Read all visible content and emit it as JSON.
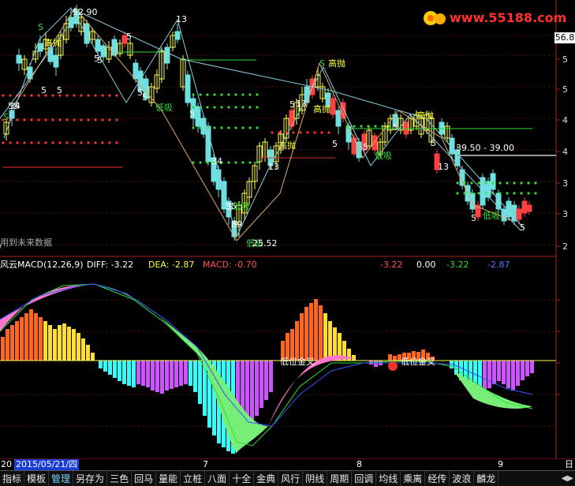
{
  "price_panel": {
    "high_label": "52.90",
    "low_label": "25.52",
    "right_axis_box": "56.8",
    "right_ticks": [
      "5",
      "5",
      "4",
      "4",
      "3",
      "3",
      "2"
    ],
    "range_label": "39.50 - 39.00",
    "future_data_note": "用到未来数据",
    "wave_labels": [
      "5",
      "5",
      "5",
      "5",
      "5",
      "13",
      "5",
      "5",
      "5",
      "13",
      "5",
      "5",
      "5",
      "5",
      "55",
      "34",
      "13",
      "5",
      "5",
      "5",
      "13",
      "34",
      "5",
      "55",
      "89"
    ],
    "signal_top": "S",
    "signal_gao": "高抛",
    "signal_di": "低吸",
    "signal_s": "S"
  },
  "macd_panel": {
    "title": "风云MACD(12,26,9)",
    "diff_text": "DIFF: -3.22",
    "dea_text": "DEA: -2.87",
    "macd_text": "MACD: -0.70",
    "right_info": [
      "-3.22",
      "0.00",
      "-3.22",
      "-2.87"
    ],
    "gold_cross_labels": [
      "低位金叉",
      "低位金叉"
    ]
  },
  "date_axis": {
    "start_label": "20",
    "selected_date": "2015/05/21/四",
    "month_labels": [
      "7",
      "8",
      "9"
    ],
    "end_label": "日"
  },
  "logo": {
    "text": "www.55188.com"
  },
  "tabs": [
    {
      "label": "指标"
    },
    {
      "label": "模板"
    },
    {
      "label": "管理"
    },
    {
      "label": "另存为"
    },
    {
      "label": "三色"
    },
    {
      "label": "回马"
    },
    {
      "label": "量能"
    },
    {
      "label": "立桩"
    },
    {
      "label": "八面"
    },
    {
      "label": "十全"
    },
    {
      "label": "金典"
    },
    {
      "label": "风行"
    },
    {
      "label": "阴线"
    },
    {
      "label": "周期"
    },
    {
      "label": "回调"
    },
    {
      "label": "均线"
    },
    {
      "label": "乘离"
    },
    {
      "label": "经传"
    },
    {
      "label": "波浪"
    },
    {
      "label": "麟龙"
    }
  ],
  "active_tab": "管理",
  "colors": {
    "up": "#ffff55",
    "down": "#6fe0e0",
    "red": "#ff4040",
    "green": "#33dd33",
    "macd_up": "#ff6622",
    "macd_down": "#33ffff",
    "macd_purple": "#cc55ff",
    "pink": "#ff77cc"
  }
}
